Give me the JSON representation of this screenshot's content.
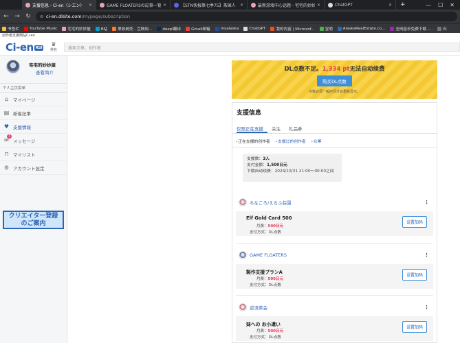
{
  "browser": {
    "tabs": [
      {
        "title": "支援信息 - Ci-en（シエン）",
        "active": true,
        "color": "#e7a3b0"
      },
      {
        "title": "GAME FLOATERSの記事一覧 - Ci-en",
        "active": false,
        "color": "#e7a3b0"
      },
      {
        "title": "【STN快报第七季75】茶国人",
        "active": false,
        "color": "#5865f2"
      },
      {
        "title": "最新游戏中心话题 - 宅宅的妙妙屋",
        "active": false,
        "color": "#e7a3b0"
      },
      {
        "title": "ChatGPT",
        "active": false,
        "color": "#dddddd"
      }
    ],
    "new_tab": "+",
    "window_buttons": [
      "—",
      "☐",
      "✕"
    ],
    "address": {
      "host": "ci-en.dlsite.com",
      "path": "/mypage/subscription"
    },
    "bookmarks": [
      {
        "label": "书签栏",
        "color": "#f0c33c"
      },
      {
        "label": "YouTube Music",
        "color": "#ff0000"
      },
      {
        "label": "宅宅的妙妙屋",
        "color": "#e7a3b0"
      },
      {
        "label": "B站",
        "color": "#00a1d6"
      },
      {
        "label": "果核剥壳 - 互联网...",
        "color": "#ff7b2b"
      },
      {
        "label": "deepl翻译",
        "color": "#0f2b46"
      },
      {
        "label": "Gmail邮箱",
        "color": "#ea4335"
      },
      {
        "label": "myalaska",
        "color": "#1f4e9a"
      },
      {
        "label": "ChatGPT",
        "color": "#dddddd"
      },
      {
        "label": "我的内容 | Microsof...",
        "color": "#f25022"
      },
      {
        "label": "宝明",
        "color": "#4caf50"
      },
      {
        "label": "AlaskaRealEstate.co...",
        "color": "#2b6cb0"
      },
      {
        "label": "全网音乐免费下载 -...",
        "color": "#9c27b0"
      },
      {
        "label": "石",
        "color": "#777777"
      }
    ]
  },
  "site": {
    "notice": "创作者支援网站Ci-en",
    "logo": "Ci-en",
    "logo_badge": "R18",
    "rank_label": "排名",
    "search_placeholder": "搜索文章、创作者"
  },
  "sidebar": {
    "profile_name": "宅宅的妙妙屋",
    "profile_view": "查看简介",
    "section_label": "个人主页菜单",
    "items": [
      {
        "label": "マイページ",
        "icon": "home-icon"
      },
      {
        "label": "新着記事",
        "icon": "document-icon"
      },
      {
        "label": "支援情報",
        "icon": "heart-icon",
        "active": true
      },
      {
        "label": "メッセージ",
        "icon": "mail-icon",
        "badge": "1"
      },
      {
        "label": "マイリスト",
        "icon": "bookmark-icon"
      },
      {
        "label": "アカウント設定",
        "icon": "gear-icon"
      }
    ],
    "creator_banner": {
      "line1": "クリエイター登録",
      "line2": "のご案内"
    }
  },
  "alert": {
    "title_prefix": "DL点数不足。",
    "points": "1,334 pt",
    "title_suffix": "无法自动续费",
    "button": "购买DL点数",
    "note": "点数必须一般时间才会重新显示。"
  },
  "support": {
    "title": "支援信息",
    "tabs": [
      "仅限正在支援",
      "关注",
      "礼品券"
    ],
    "subnav": [
      {
        "label": "正在支援的创作者",
        "current": true
      },
      {
        "label": "支援过的创作者",
        "current": false
      },
      {
        "label": "众筹",
        "current": false
      }
    ],
    "summary": {
      "count_label": "支援数：",
      "count_value": "3人",
      "total_label": "支付金额：",
      "total_value": "1,500日元",
      "next_label": "下期自动续费：",
      "next_value": "2024/10/31 21:00～00:00之间"
    },
    "creators": [
      {
        "name": "ちなころ/えるふ荘園",
        "plan": "Elf Gold Card 500",
        "fee_label": "月费：",
        "fee": "500日元",
        "pay_label": "支付方式：",
        "pay": "DL点数",
        "button": "设置加码"
      },
      {
        "name": "GAME FLOATERS",
        "plan": "製作支援プランA",
        "fee_label": "月费：",
        "fee": "500日元",
        "pay_label": "支付方式：",
        "pay": "DL点数",
        "button": "设置加码"
      },
      {
        "name": "逆流茶会",
        "plan": "妹への お小遣い",
        "fee_label": "月费：",
        "fee": "500日元",
        "pay_label": "支付方式：",
        "pay": "DL点数",
        "button": "设置加码"
      }
    ]
  }
}
